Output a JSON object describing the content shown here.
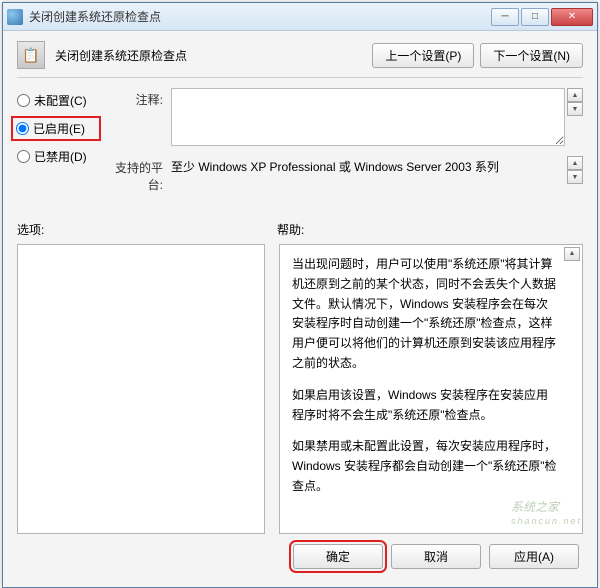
{
  "window": {
    "title": "关闭创建系统还原检查点"
  },
  "header": {
    "title": "关闭创建系统还原检查点",
    "prev_btn": "上一个设置(P)",
    "next_btn": "下一个设置(N)"
  },
  "radios": {
    "not_configured": "未配置(C)",
    "enabled": "已启用(E)",
    "disabled": "已禁用(D)"
  },
  "fields": {
    "note_label": "注释:",
    "platform_label": "支持的平台:",
    "platform_value": "至少 Windows XP Professional 或 Windows Server 2003 系列"
  },
  "sections": {
    "options_label": "选项:",
    "help_label": "帮助:"
  },
  "help": {
    "p1": "当出现问题时，用户可以使用\"系统还原\"将其计算机还原到之前的某个状态，同时不会丢失个人数据文件。默认情况下，Windows 安装程序会在每次安装程序时自动创建一个\"系统还原\"检查点，这样用户便可以将他们的计算机还原到安装该应用程序之前的状态。",
    "p2": "如果启用该设置，Windows 安装程序在安装应用程序时将不会生成\"系统还原\"检查点。",
    "p3": "如果禁用或未配置此设置，每次安装应用程序时，Windows 安装程序都会自动创建一个\"系统还原\"检查点。"
  },
  "footer": {
    "ok": "确定",
    "cancel": "取消",
    "apply": "应用(A)"
  },
  "watermark": {
    "main": "系统之家",
    "sub": "shancun.net"
  }
}
